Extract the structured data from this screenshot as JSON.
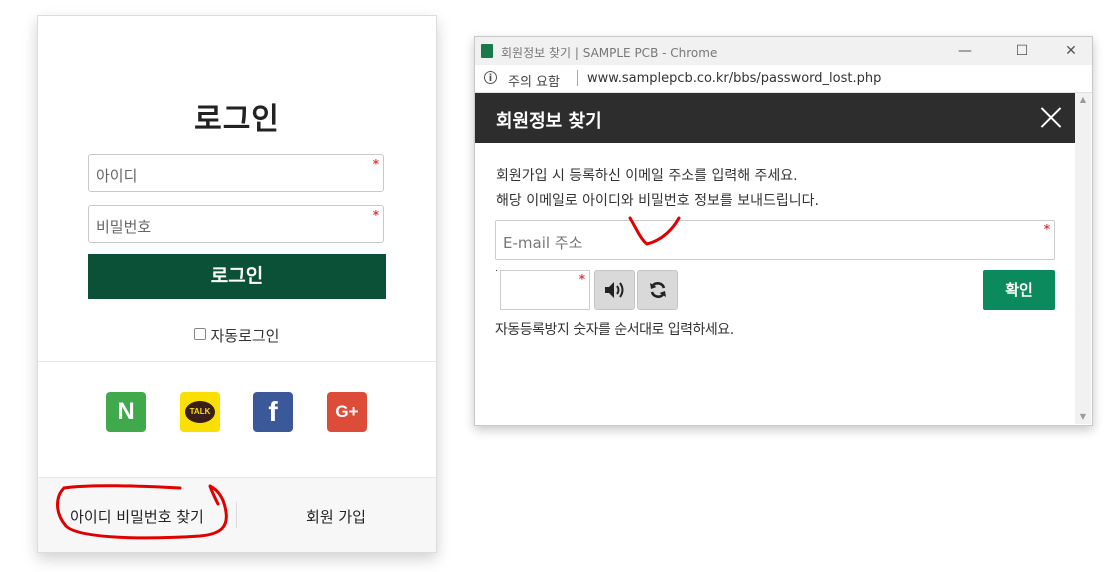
{
  "login": {
    "title": "로그인",
    "id_placeholder": "아이디",
    "password_placeholder": "비밀번호",
    "required_mark": "*",
    "login_button": "로그인",
    "auto_login_label": "자동로그인",
    "social": [
      {
        "name": "naver",
        "icon": "naver-icon",
        "glyph": "N",
        "color": "#3fa94b"
      },
      {
        "name": "kakao",
        "icon": "kakao-talk-icon",
        "glyph": "TALK",
        "color": "#f9e000"
      },
      {
        "name": "facebook",
        "icon": "facebook-icon",
        "glyph": "f",
        "color": "#3b5998"
      },
      {
        "name": "google",
        "icon": "google-plus-icon",
        "glyph": "G+",
        "color": "#dd4b39"
      }
    ],
    "find_link": "아이디 비밀번호 찾기",
    "join_link": "회원 가입",
    "button_color": "#0b5138"
  },
  "popup_window": {
    "title": "회원정보 찾기 | SAMPLE PCB - Chrome",
    "security_label": "주의 요함",
    "url": "www.samplepcb.co.kr/bbs/password_lost.php",
    "modal_title": "회원정보 찾기",
    "description_line1": "회원가입 시 등록하신 이메일 주소를 입력해 주세요.",
    "description_line2": "해당 이메일로 아이디와 비밀번호 정보를 보내드립니다.",
    "email_placeholder": "E-mail 주소",
    "required_mark": "*",
    "captcha_dot": ".",
    "confirm_button": "확인",
    "captcha_help": "자동등록방지 숫자를 순서대로 입력하세요.",
    "confirm_color": "#0b8a5e"
  },
  "annotation_color": "#e00000"
}
